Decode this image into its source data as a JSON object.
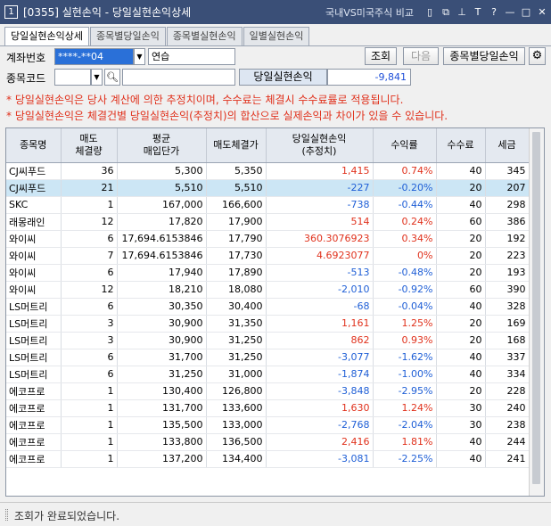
{
  "window": {
    "number": "1",
    "title": "[0355] 실현손익 - 당일실현손익상세",
    "link": "국내VS미국주식 비교",
    "icons": [
      "document-icon",
      "restore-window-icon",
      "pin-icon",
      "font-size-icon",
      "help-icon",
      "minimize-icon",
      "maximize-icon",
      "close-icon"
    ],
    "icon_glyphs": [
      "▯",
      "⧉",
      "⊥",
      "T",
      "?",
      "—",
      "□",
      "✕"
    ]
  },
  "tabs": [
    {
      "label": "당일실현손익상세",
      "active": true
    },
    {
      "label": "종목별당일손익",
      "active": false
    },
    {
      "label": "종목별실현손익",
      "active": false
    },
    {
      "label": "일별실현손익",
      "active": false
    }
  ],
  "form": {
    "account_label": "계좌번호",
    "account_value": "****-**04",
    "account_name": "연습",
    "code_label": "종목코드",
    "code_value": "",
    "name_value": "",
    "query_button": "조회",
    "next_button": "다음",
    "by_stock_button": "종목별당일손익",
    "pnl_label": "당일실현손익",
    "pnl_value": "-9,841"
  },
  "notes": [
    "* 당일실현손익은 당사 계산에 의한 추정치이며, 수수료는 체결시 수수료률로 적용됩니다.",
    "* 당일실현손익은 체결건별 당일실현손익(추정치)의 합산으로 실제손익과 차이가 있을 수 있습니다."
  ],
  "table": {
    "headers": [
      "종목명",
      "매도\n체결량",
      "평균\n매입단가",
      "매도체결가",
      "당일실현손익\n(추정치)",
      "수익률",
      "수수료",
      "세금"
    ],
    "rows": [
      {
        "name": "CJ씨푸드",
        "qty": "36",
        "avg": "5,300",
        "sell": "5,350",
        "pnl": "1,415",
        "rate": "0.74%",
        "fee": "40",
        "tax": "345",
        "sign": "pos",
        "selected": false
      },
      {
        "name": "CJ씨푸드",
        "qty": "21",
        "avg": "5,510",
        "sell": "5,510",
        "pnl": "-227",
        "rate": "-0.20%",
        "fee": "20",
        "tax": "207",
        "sign": "neg",
        "selected": true
      },
      {
        "name": "SKC",
        "qty": "1",
        "avg": "167,000",
        "sell": "166,600",
        "pnl": "-738",
        "rate": "-0.44%",
        "fee": "40",
        "tax": "298",
        "sign": "neg",
        "selected": false
      },
      {
        "name": "래몽래인",
        "qty": "12",
        "avg": "17,820",
        "sell": "17,900",
        "pnl": "514",
        "rate": "0.24%",
        "fee": "60",
        "tax": "386",
        "sign": "pos",
        "selected": false
      },
      {
        "name": "와이씨",
        "qty": "6",
        "avg": "17,694.6153846",
        "sell": "17,790",
        "pnl": "360.3076923",
        "rate": "0.34%",
        "fee": "20",
        "tax": "192",
        "sign": "pos",
        "selected": false
      },
      {
        "name": "와이씨",
        "qty": "7",
        "avg": "17,694.6153846",
        "sell": "17,730",
        "pnl": "4.6923077",
        "rate": "0%",
        "fee": "20",
        "tax": "223",
        "sign": "pos",
        "selected": false
      },
      {
        "name": "와이씨",
        "qty": "6",
        "avg": "17,940",
        "sell": "17,890",
        "pnl": "-513",
        "rate": "-0.48%",
        "fee": "20",
        "tax": "193",
        "sign": "neg",
        "selected": false
      },
      {
        "name": "와이씨",
        "qty": "12",
        "avg": "18,210",
        "sell": "18,080",
        "pnl": "-2,010",
        "rate": "-0.92%",
        "fee": "60",
        "tax": "390",
        "sign": "neg",
        "selected": false
      },
      {
        "name": "LS머트리",
        "qty": "6",
        "avg": "30,350",
        "sell": "30,400",
        "pnl": "-68",
        "rate": "-0.04%",
        "fee": "40",
        "tax": "328",
        "sign": "neg",
        "selected": false
      },
      {
        "name": "LS머트리",
        "qty": "3",
        "avg": "30,900",
        "sell": "31,350",
        "pnl": "1,161",
        "rate": "1.25%",
        "fee": "20",
        "tax": "169",
        "sign": "pos",
        "selected": false
      },
      {
        "name": "LS머트리",
        "qty": "3",
        "avg": "30,900",
        "sell": "31,250",
        "pnl": "862",
        "rate": "0.93%",
        "fee": "20",
        "tax": "168",
        "sign": "pos",
        "selected": false
      },
      {
        "name": "LS머트리",
        "qty": "6",
        "avg": "31,700",
        "sell": "31,250",
        "pnl": "-3,077",
        "rate": "-1.62%",
        "fee": "40",
        "tax": "337",
        "sign": "neg",
        "selected": false
      },
      {
        "name": "LS머트리",
        "qty": "6",
        "avg": "31,250",
        "sell": "31,000",
        "pnl": "-1,874",
        "rate": "-1.00%",
        "fee": "40",
        "tax": "334",
        "sign": "neg",
        "selected": false
      },
      {
        "name": "에코프로",
        "qty": "1",
        "avg": "130,400",
        "sell": "126,800",
        "pnl": "-3,848",
        "rate": "-2.95%",
        "fee": "20",
        "tax": "228",
        "sign": "neg",
        "selected": false
      },
      {
        "name": "에코프로",
        "qty": "1",
        "avg": "131,700",
        "sell": "133,600",
        "pnl": "1,630",
        "rate": "1.24%",
        "fee": "30",
        "tax": "240",
        "sign": "pos",
        "selected": false
      },
      {
        "name": "에코프로",
        "qty": "1",
        "avg": "135,500",
        "sell": "133,000",
        "pnl": "-2,768",
        "rate": "-2.04%",
        "fee": "30",
        "tax": "238",
        "sign": "neg",
        "selected": false
      },
      {
        "name": "에코프로",
        "qty": "1",
        "avg": "133,800",
        "sell": "136,500",
        "pnl": "2,416",
        "rate": "1.81%",
        "fee": "40",
        "tax": "244",
        "sign": "pos",
        "selected": false
      },
      {
        "name": "에코프로",
        "qty": "1",
        "avg": "137,200",
        "sell": "134,400",
        "pnl": "-3,081",
        "rate": "-2.25%",
        "fee": "40",
        "tax": "241",
        "sign": "neg",
        "selected": false
      }
    ]
  },
  "status": {
    "message": "조회가 완료되었습니다."
  },
  "colors": {
    "positive": "#e0311c",
    "negative": "#1f5fd6",
    "selected_row": "#cce6f5",
    "titlebar": "#3a4f77"
  }
}
